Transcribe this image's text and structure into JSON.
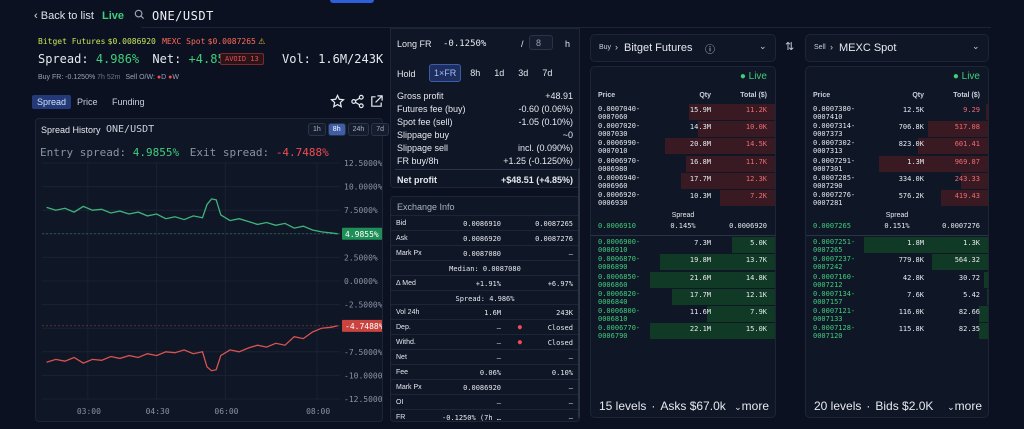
{
  "top": {
    "back_label": "Back to list",
    "live_label": "Live",
    "pair": "ONE/USDT"
  },
  "summary": {
    "buy_exchange": "Bitget Futures",
    "buy_price": "$0.0086920",
    "sell_exchange": "MEXC Spot",
    "sell_price": "$0.0087265",
    "spread_label": "Spread:",
    "spread_value": "4.986%",
    "net_label": "Net:",
    "net_value": "+4.85%",
    "avoid_badge": "AVOID 13",
    "vol_label": "Vol:",
    "vol_value": "1.6M/243K",
    "buy_fr": "Buy FR: -0.1250% ",
    "buy_fr_time": "7h 52m",
    "sell_ow": "Sell O/W:",
    "dep_flag": "D",
    "wd_flag": "W"
  },
  "tabs": {
    "spread": "Spread",
    "price": "Price",
    "funding": "Funding"
  },
  "chart_panel": {
    "title": "Spread History",
    "pair": "ONE/USDT",
    "ranges": [
      "1h",
      "8h",
      "24h",
      "7d"
    ],
    "active_range": "8h",
    "entry_label": "Entry spread:",
    "entry_value": "4.9855%",
    "exit_label": "Exit spread:",
    "exit_value": "-4.7488%"
  },
  "chart_data": {
    "type": "line",
    "x_ticks": [
      "03:00",
      "04:30",
      "06:00",
      "08:00"
    ],
    "y_ticks": [
      "12.5000%",
      "10.0000%",
      "7.5000%",
      "5.0000%",
      "2.5000%",
      "0.0000%",
      "-2.5000%",
      "-5.0000%",
      "-7.5000%",
      "-10.0000%",
      "-12.5000%"
    ],
    "ylim": [
      -12.5,
      12.5
    ],
    "xlim": [
      2,
      8.5
    ],
    "series": [
      {
        "name": "Entry spread",
        "color": "#3fb37a",
        "x": [
          2.1,
          2.3,
          2.5,
          2.7,
          2.9,
          3.1,
          3.3,
          3.5,
          3.7,
          3.9,
          4.1,
          4.3,
          4.5,
          4.7,
          4.9,
          5.1,
          5.3,
          5.5,
          5.6,
          5.7,
          5.8,
          5.9,
          6.1,
          6.3,
          6.5,
          6.7,
          6.9,
          7.1,
          7.3,
          7.5,
          7.7,
          7.9,
          8.1,
          8.3,
          8.45
        ],
        "y": [
          7.8,
          7.5,
          7.7,
          7.3,
          7.9,
          7.5,
          7.6,
          7.2,
          7.4,
          7.1,
          7.3,
          6.9,
          7.1,
          6.6,
          6.8,
          6.5,
          6.9,
          6.7,
          8.1,
          8.7,
          8.6,
          7.0,
          6.4,
          6.6,
          6.3,
          6.0,
          6.2,
          5.9,
          6.1,
          5.6,
          5.8,
          5.4,
          5.2,
          5.1,
          5.0
        ],
        "last_label": "4.9855%"
      },
      {
        "name": "Exit spread",
        "color": "#d9534f",
        "x": [
          2.1,
          2.3,
          2.5,
          2.7,
          2.9,
          3.1,
          3.3,
          3.5,
          3.7,
          3.9,
          4.1,
          4.3,
          4.5,
          4.7,
          4.9,
          5.1,
          5.3,
          5.5,
          5.6,
          5.7,
          5.8,
          5.9,
          6.1,
          6.3,
          6.5,
          6.7,
          6.9,
          7.1,
          7.3,
          7.5,
          7.7,
          7.9,
          8.1,
          8.3,
          8.45
        ],
        "y": [
          -8.6,
          -8.3,
          -8.5,
          -8.1,
          -8.7,
          -8.3,
          -8.4,
          -8.0,
          -8.2,
          -7.9,
          -8.1,
          -7.7,
          -7.9,
          -7.5,
          -7.6,
          -7.3,
          -7.7,
          -7.5,
          -9.1,
          -9.5,
          -9.4,
          -7.9,
          -7.3,
          -7.5,
          -7.1,
          -6.8,
          -7.0,
          -6.6,
          -6.8,
          -5.9,
          -6.1,
          -5.4,
          -5.0,
          -4.9,
          -4.75
        ],
        "last_label": "-4.7488%"
      }
    ]
  },
  "calc": {
    "long_fr_label": "Long FR",
    "long_fr_value": "-0.1250%",
    "fr_divisor": "8",
    "fr_unit": "h",
    "hold_label": "Hold",
    "hold_options": [
      "1×FR",
      "8h",
      "1d",
      "3d",
      "7d"
    ],
    "hold_active": "1×FR",
    "rows": [
      {
        "label": "Gross profit",
        "value": "+48.91"
      },
      {
        "label": "Futures fee (buy)",
        "value": "-0.60 (0.06%)"
      },
      {
        "label": "Spot fee (sell)",
        "value": "-1.05 (0.10%)"
      },
      {
        "label": "Slippage buy",
        "value": "~0"
      },
      {
        "label": "Slippage sell",
        "value": "incl. (0.090%)"
      },
      {
        "label": "FR buy/8h",
        "value": "+1.25 (-0.1250%)"
      }
    ],
    "net_label": "Net profit",
    "net_value": "+$48.51 (+4.85%)"
  },
  "exchange_info": {
    "title": "Exchange Info",
    "rows": [
      {
        "label": "Bid",
        "a": "0.0086910",
        "b": "0.0087265"
      },
      {
        "label": "Ask",
        "a": "0.0086920",
        "b": "0.0087276"
      },
      {
        "label": "Mark Px",
        "a": "0.0087080",
        "b": "—"
      },
      {
        "label": "",
        "full": "Median: 0.0087080"
      },
      {
        "label": "Δ Med",
        "a": "+1.91%",
        "b": "+6.97%"
      },
      {
        "label": "",
        "full": "Spread: 4.986%"
      },
      {
        "label": "Vol 24h",
        "a": "1.6M",
        "b": "243K"
      },
      {
        "label": "Dep.",
        "a": "—",
        "b": "Closed"
      },
      {
        "label": "Withd.",
        "a": "—",
        "b": "Closed"
      },
      {
        "label": "Net",
        "a": "—",
        "b": "—"
      },
      {
        "label": "Fee",
        "a": "0.06%",
        "b": "0.10%"
      },
      {
        "label": "Mark Px",
        "a": "0.0086920",
        "b": "—"
      },
      {
        "label": "OI",
        "a": "—",
        "b": "—"
      },
      {
        "label": "FR",
        "a": "-0.1250% (7h …",
        "b": "—"
      }
    ]
  },
  "book_buy": {
    "side": "Buy",
    "exchange": "Bitget Futures",
    "live": "Live",
    "headers": [
      "Price",
      "Qty",
      "Total ($)"
    ],
    "asks": [
      {
        "p1": "0.0007040-",
        "p2": "0007060",
        "q": "15.9M",
        "t": "11.2K",
        "w": 0.78
      },
      {
        "p1": "0.0007020-",
        "p2": "0007030",
        "q": "14.3M",
        "t": "10.0K",
        "w": 0.7
      },
      {
        "p1": "0.0006990-",
        "p2": "0007010",
        "q": "20.8M",
        "t": "14.5K",
        "w": 1.0
      },
      {
        "p1": "0.0006970-",
        "p2": "0006980",
        "q": "16.8M",
        "t": "11.7K",
        "w": 0.81
      },
      {
        "p1": "0.0006940-",
        "p2": "0006960",
        "q": "17.7M",
        "t": "12.3K",
        "w": 0.85
      },
      {
        "p1": "0.0006920-",
        "p2": "0006930",
        "q": "10.3M",
        "t": "7.2K",
        "w": 0.5
      }
    ],
    "spread_label": "Spread",
    "spread_bid": "0.0006910",
    "spread_pct": "0.145%",
    "spread_ask": "0.0006920",
    "bids": [
      {
        "p1": "0.0006900-",
        "p2": "0006910",
        "q": "7.3M",
        "t": "5.0K",
        "w": 0.34
      },
      {
        "p1": "0.0006870-",
        "p2": "0006890",
        "q": "19.8M",
        "t": "13.7K",
        "w": 0.92
      },
      {
        "p1": "0.0006850-",
        "p2": "0006860",
        "q": "21.6M",
        "t": "14.8K",
        "w": 1.0
      },
      {
        "p1": "0.0006820-",
        "p2": "0006840",
        "q": "17.7M",
        "t": "12.1K",
        "w": 0.82
      },
      {
        "p1": "0.0006800-",
        "p2": "0006810",
        "q": "11.6M",
        "t": "7.9K",
        "w": 0.54
      },
      {
        "p1": "0.0006770-",
        "p2": "0006790",
        "q": "22.1M",
        "t": "15.0K",
        "w": 1.0
      }
    ],
    "levels": "15 levels",
    "sum_label": "Asks $67.0k",
    "more": "more"
  },
  "book_sell": {
    "side": "Sell",
    "exchange": "MEXC Spot",
    "live": "Live",
    "headers": [
      "Price",
      "Qty",
      "Total ($)"
    ],
    "asks": [
      {
        "p1": "0.0007380-",
        "p2": "0007410",
        "q": "12.5K",
        "t": "9.29",
        "w": 0.02
      },
      {
        "p1": "0.0007314-",
        "p2": "0007373",
        "q": "706.8K",
        "t": "517.08",
        "w": 0.55
      },
      {
        "p1": "0.0007302-",
        "p2": "0007313",
        "q": "823.0K",
        "t": "601.41",
        "w": 0.64
      },
      {
        "p1": "0.0007291-",
        "p2": "0007301",
        "q": "1.3M",
        "t": "969.87",
        "w": 1.0
      },
      {
        "p1": "0.0007285-",
        "p2": "0007290",
        "q": "334.0K",
        "t": "243.33",
        "w": 0.25
      },
      {
        "p1": "0.0007276-",
        "p2": "0007281",
        "q": "576.2K",
        "t": "419.43",
        "w": 0.43
      }
    ],
    "spread_label": "Spread",
    "spread_bid": "0.0007265",
    "spread_pct": "0.151%",
    "spread_ask": "0.0007276",
    "bids": [
      {
        "p1": "0.0007251-",
        "p2": "0007265",
        "q": "1.8M",
        "t": "1.3K",
        "w": 1.0
      },
      {
        "p1": "0.0007237-",
        "p2": "0007242",
        "q": "779.8K",
        "t": "564.32",
        "w": 0.45
      },
      {
        "p1": "0.0007160-",
        "p2": "0007212",
        "q": "42.8K",
        "t": "30.72",
        "w": 0.03
      },
      {
        "p1": "0.0007134-",
        "p2": "0007157",
        "q": "7.6K",
        "t": "5.42",
        "w": 0.01
      },
      {
        "p1": "0.0007121-",
        "p2": "0007133",
        "q": "116.0K",
        "t": "82.66",
        "w": 0.07
      },
      {
        "p1": "0.0007128-",
        "p2": "0007120",
        "q": "115.8K",
        "t": "82.35",
        "w": 0.07
      }
    ],
    "levels": "20 levels",
    "sum_label": "Bids $2.0K",
    "more": "more"
  }
}
